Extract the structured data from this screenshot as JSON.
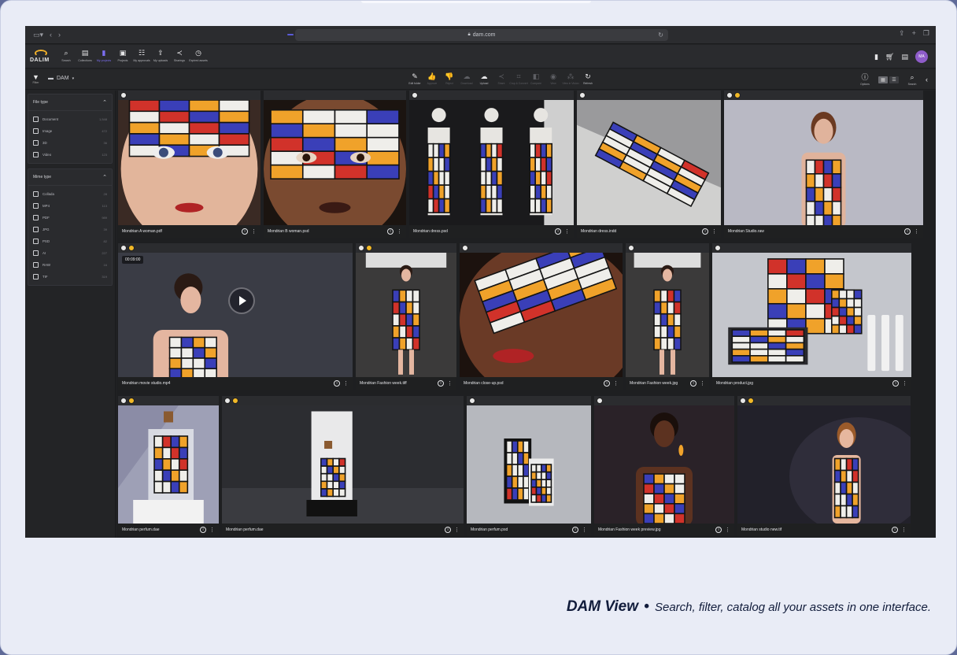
{
  "browser": {
    "url": "dam.com",
    "left_icons": [
      "sidebar-icon",
      "chevron-left-icon",
      "chevron-right-icon"
    ],
    "right_icons": [
      "share-icon",
      "plus-icon",
      "tabs-icon"
    ]
  },
  "nav": {
    "logo_text": "DALIM",
    "items": [
      {
        "label": "Search",
        "icon": "⌕",
        "name": "search"
      },
      {
        "label": "Collections",
        "icon": "▤",
        "name": "collections"
      },
      {
        "label": "My projects",
        "icon": "▮",
        "name": "my-projects",
        "active": true
      },
      {
        "label": "Projects",
        "icon": "▣",
        "name": "projects"
      },
      {
        "label": "My approvals",
        "icon": "☷",
        "name": "my-approvals"
      },
      {
        "label": "My uploads",
        "icon": "⇪",
        "name": "my-uploads"
      },
      {
        "label": "Sharings",
        "icon": "≺",
        "name": "sharings"
      },
      {
        "label": "Expired assets",
        "icon": "◷",
        "name": "expired-assets"
      }
    ],
    "avatar": "MA"
  },
  "toolbar": {
    "filter_label": "Filter",
    "folder": "DAM",
    "actions": [
      {
        "label": "Edit folder",
        "icon": "✎",
        "dim": false
      },
      {
        "label": "Approve",
        "icon": "👍",
        "dim": true
      },
      {
        "label": "Reject",
        "icon": "👎",
        "dim": true
      },
      {
        "label": "Download",
        "icon": "☁",
        "dim": true
      },
      {
        "label": "Upload",
        "icon": "☁",
        "dim": false
      },
      {
        "label": "Share",
        "icon": "≺",
        "dim": true
      },
      {
        "label": "Crop & Convert",
        "icon": "⌗",
        "dim": true
      },
      {
        "label": "Compare",
        "icon": "◧",
        "dim": true
      },
      {
        "label": "View",
        "icon": "◉",
        "dim": true
      },
      {
        "label": "View in Vision",
        "icon": "⁂",
        "dim": true
      },
      {
        "label": "Refresh",
        "icon": "↻",
        "dim": false
      }
    ],
    "options_label": "Options",
    "search_label": "Search"
  },
  "sidebar": {
    "facets": [
      {
        "title": "File type",
        "rows": [
          {
            "label": "Document",
            "count": "1,548"
          },
          {
            "label": "Image",
            "count": "472"
          },
          {
            "label": "3D",
            "count": "36"
          },
          {
            "label": "Video",
            "count": "123"
          }
        ]
      },
      {
        "title": "Mime type",
        "rows": [
          {
            "label": "Collada",
            "count": "28"
          },
          {
            "label": "MP4",
            "count": "113"
          },
          {
            "label": "PDF",
            "count": "989"
          },
          {
            "label": "JPG",
            "count": "39"
          },
          {
            "label": "PSD",
            "count": "82"
          },
          {
            "label": "AI",
            "count": "227"
          },
          {
            "label": "RAW",
            "count": "16"
          },
          {
            "label": "TIF",
            "count": "319"
          }
        ]
      }
    ]
  },
  "assets": [
    {
      "name": "Mondrian A woman.pdf",
      "badges": [
        "white"
      ],
      "art": "face-light"
    },
    {
      "name": "Mondrian B woman.psd",
      "badges": [],
      "art": "face-dark"
    },
    {
      "name": "Mondrian dress.psd",
      "badges": [
        "white"
      ],
      "art": "mannequins"
    },
    {
      "name": "Mondrian dress.indd",
      "badges": [
        "white"
      ],
      "art": "dress-lying"
    },
    {
      "name": "Mondrian Studio.raw",
      "badges": [
        "white",
        "gold"
      ],
      "art": "studio-woman"
    },
    {
      "name": "Mondrian movie studio.mp4",
      "badges": [
        "white",
        "gold"
      ],
      "art": "movie",
      "duration": "00:09:00"
    },
    {
      "name": "Mondrian Fashion week.tiff",
      "badges": [
        "white",
        "gold"
      ],
      "art": "runway"
    },
    {
      "name": "Mondrian close-up.psd",
      "badges": [
        "white"
      ],
      "art": "closeup"
    },
    {
      "name": "Mondrian Fashion week.jpg",
      "badges": [
        "white"
      ],
      "art": "runway2"
    },
    {
      "name": "Mondrian product.jpg",
      "badges": [
        "white"
      ],
      "art": "product"
    },
    {
      "name": "Mondrian perfum.dae",
      "badges": [
        "white",
        "gold"
      ],
      "art": "perfume1"
    },
    {
      "name": "Mondrian perfum.dae",
      "badges": [
        "white",
        "gold"
      ],
      "art": "perfume2"
    },
    {
      "name": "Mondrian perfum.psd",
      "badges": [
        "white"
      ],
      "art": "perfume3"
    },
    {
      "name": "Mondrian Fashion week preview.jpg",
      "badges": [
        "white"
      ],
      "art": "fashion-preview"
    },
    {
      "name": "Mondrian studio new.tif",
      "badges": [
        "white",
        "gold"
      ],
      "art": "studio-new"
    }
  ],
  "colors": {
    "mondrian_red": "#d1322a",
    "mondrian_blue": "#3a3fb8",
    "mondrian_yellow": "#f0a22a",
    "accent": "#7b6ef0"
  },
  "caption": {
    "title": "DAM View",
    "bullet": "•",
    "text": "Search, filter, catalog all your assets in one interface."
  }
}
